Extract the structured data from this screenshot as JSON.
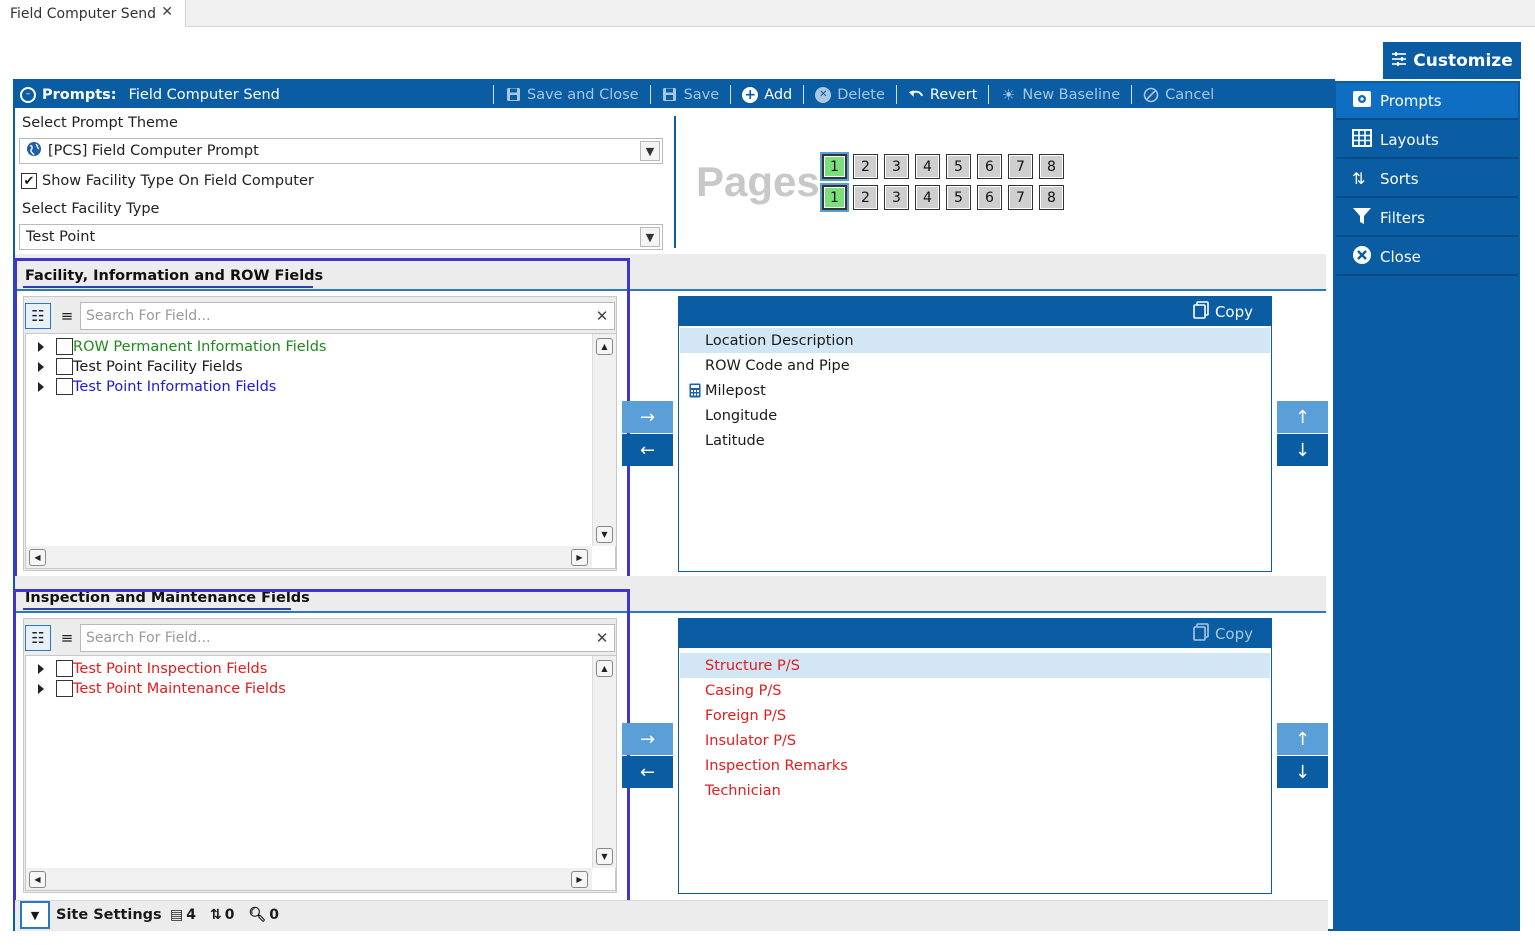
{
  "tab": {
    "title": "Field Computer Send",
    "close": "✕"
  },
  "customize": {
    "label": "Customize"
  },
  "toolbar": {
    "prefix": "Prompts:",
    "title": "Field Computer Send",
    "buttons": [
      {
        "label": "Save and Close",
        "icon": "floppy-icon",
        "enabled": false
      },
      {
        "label": "Save",
        "icon": "floppy-icon",
        "enabled": false
      },
      {
        "label": "Add",
        "icon": "plus-circle-icon",
        "enabled": true
      },
      {
        "label": "Delete",
        "icon": "x-circle-icon",
        "enabled": false
      },
      {
        "label": "Revert",
        "icon": "undo-icon",
        "enabled": true
      },
      {
        "label": "New Baseline",
        "icon": "sun-icon",
        "enabled": false
      },
      {
        "label": "Cancel",
        "icon": "cancel-icon",
        "enabled": false
      }
    ]
  },
  "sidebar": {
    "items": [
      {
        "label": "Prompts",
        "icon": "prompts-icon",
        "active": true
      },
      {
        "label": "Layouts",
        "icon": "grid-icon",
        "active": false
      },
      {
        "label": "Sorts",
        "icon": "sort-icon",
        "active": false
      },
      {
        "label": "Filters",
        "icon": "filter-icon",
        "active": false
      },
      {
        "label": "Close",
        "icon": "close-circle-icon",
        "active": false
      }
    ]
  },
  "form": {
    "theme_label": "Select Prompt Theme",
    "theme_value": "[PCS] Field Computer Prompt",
    "show_facility_label": "Show Facility Type On Field Computer",
    "show_facility_checked": true,
    "facility_label": "Select Facility Type",
    "facility_value": "Test Point"
  },
  "pages": {
    "label": "Pages",
    "row1": [
      "1",
      "2",
      "3",
      "4",
      "5",
      "6",
      "7",
      "8"
    ],
    "row2": [
      "1",
      "2",
      "3",
      "4",
      "5",
      "6",
      "7",
      "8"
    ],
    "selected": "1"
  },
  "section1": {
    "title": "Facility, Information and ROW Fields",
    "search_placeholder": "Search For Field...",
    "tree": [
      {
        "label": "ROW Permanent Information Fields",
        "color": "#1e8a1e"
      },
      {
        "label": "Test Point Facility Fields",
        "color": "#111111"
      },
      {
        "label": "Test Point Information Fields",
        "color": "#1a1ad9"
      }
    ],
    "copy_label": "Copy",
    "list": [
      {
        "label": "Location Description",
        "selected": true,
        "icon": ""
      },
      {
        "label": "ROW Code and Pipe",
        "selected": false,
        "icon": ""
      },
      {
        "label": "Milepost",
        "selected": false,
        "icon": "calculator-icon"
      },
      {
        "label": "Longitude",
        "selected": false,
        "icon": ""
      },
      {
        "label": "Latitude",
        "selected": false,
        "icon": ""
      }
    ]
  },
  "section2": {
    "title": "Inspection and Maintenance Fields",
    "search_placeholder": "Search For Field...",
    "tree": [
      {
        "label": "Test Point Inspection Fields",
        "color": "#e01d1d"
      },
      {
        "label": "Test Point Maintenance Fields",
        "color": "#e01d1d"
      }
    ],
    "copy_label": "Copy",
    "list": [
      {
        "label": "Structure P/S",
        "selected": true
      },
      {
        "label": "Casing P/S",
        "selected": false
      },
      {
        "label": "Foreign P/S",
        "selected": false
      },
      {
        "label": "Insulator P/S",
        "selected": false
      },
      {
        "label": "Inspection Remarks",
        "selected": false
      },
      {
        "label": "Technician",
        "selected": false
      }
    ]
  },
  "footer": {
    "title": "Site Settings",
    "count1": "4",
    "count2": "0",
    "count3": "0"
  },
  "colors": {
    "accent": "#0a5ca3",
    "highlight": "#4037c9",
    "page_selected": "#7be07b"
  }
}
